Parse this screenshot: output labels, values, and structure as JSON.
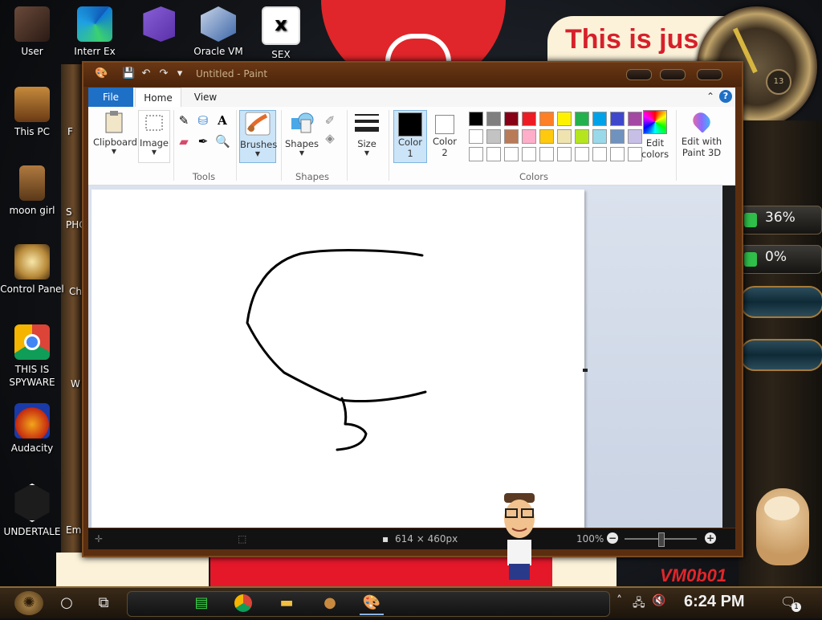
{
  "desktop": {
    "meme_text": "This is jus",
    "watermark": "VM0b01",
    "gauges": [
      "36%",
      "0%"
    ],
    "icons_col1": [
      {
        "label": "User",
        "icon": "user-folder-icon"
      },
      {
        "label": "This PC",
        "icon": "computer-icon"
      },
      {
        "label": "moon girl",
        "icon": "folder-icon"
      },
      {
        "label": "Control Panel",
        "icon": "control-panel-icon"
      },
      {
        "label": "THIS IS SPYWARE",
        "icon": "chrome-icon"
      },
      {
        "label": "Audacity",
        "icon": "audacity-icon"
      },
      {
        "label": "UNDERTALE",
        "icon": "unity-icon"
      }
    ],
    "icons_top": [
      {
        "label": "Interr Ex",
        "icon": "edge-icon"
      },
      {
        "label": "",
        "icon": "visual-studio-icon"
      },
      {
        "label": "Oracle VM",
        "icon": "virtualbox-icon"
      },
      {
        "label": "SEX",
        "icon": "hxd-icon"
      }
    ],
    "icons_col2_partial": [
      "F",
      "S PHO",
      "Ch",
      "W",
      "Emb"
    ]
  },
  "paint": {
    "title": "Untitled - Paint",
    "tabs": {
      "file": "File",
      "home": "Home",
      "view": "View"
    },
    "ribbon": {
      "clipboard": "Clipboard",
      "image": "Image",
      "tools": "Tools",
      "brushes": "Brushes",
      "shapes": "Shapes",
      "shapes_group": "Shapes",
      "size": "Size",
      "color1": "Color 1",
      "color2": "Color 2",
      "colors_group": "Colors",
      "edit_colors": "Edit colors",
      "edit_paint3d": "Edit with Paint 3D"
    },
    "palette_row1": [
      "#000000",
      "#7f7f7f",
      "#880015",
      "#ed1c24",
      "#ff7f27",
      "#fff200",
      "#22b14c",
      "#00a2e8",
      "#3f48cc",
      "#a349a4"
    ],
    "palette_row2": [
      "#ffffff",
      "#c3c3c3",
      "#b97a57",
      "#ffaec9",
      "#ffc90e",
      "#efe4b0",
      "#b5e61d",
      "#99d9ea",
      "#7092be",
      "#c8bfe7"
    ],
    "palette_row3": [
      "#ffffff",
      "#ffffff",
      "#ffffff",
      "#ffffff",
      "#ffffff",
      "#ffffff",
      "#ffffff",
      "#ffffff",
      "#ffffff",
      "#ffffff"
    ],
    "color1_value": "#000000",
    "color2_value": "#ffffff",
    "status": {
      "dimensions": "614 × 460px",
      "zoom": "100%"
    }
  },
  "taskbar": {
    "clock": "6:24 PM",
    "notifications": "1"
  }
}
